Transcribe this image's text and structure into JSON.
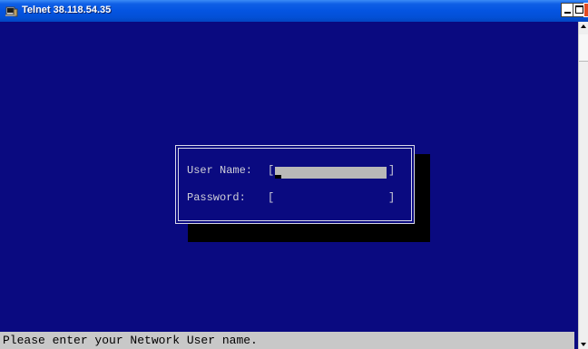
{
  "window": {
    "title": "Telnet 38.118.54.35",
    "icon": "telnet-terminal-icon",
    "controls": [
      "minimize",
      "maximize",
      "close"
    ]
  },
  "login": {
    "username_label": "User Name:",
    "password_label": "Password:",
    "bracket_open": "[",
    "bracket_close": "]",
    "username_value": "",
    "password_value": ""
  },
  "status": {
    "message": "Please enter your Network User name."
  },
  "colors": {
    "terminal_bg": "#0a0a80",
    "titlebar": "#0454e1",
    "text": "#d0d0d8",
    "input_highlight": "#b8b8b8",
    "status_bg": "#c8c8c8"
  }
}
